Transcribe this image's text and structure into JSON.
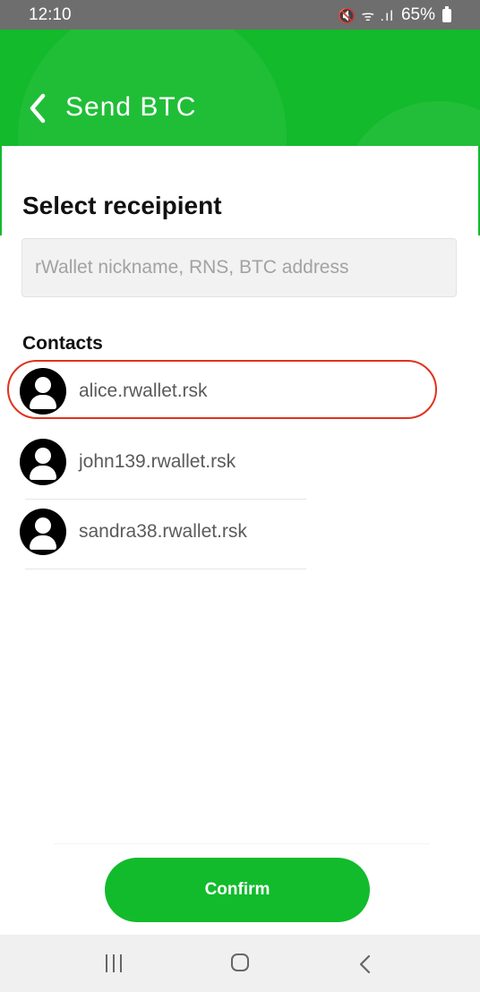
{
  "status_bar": {
    "time": "12:10",
    "icons": "🔇 ᯤ .ıl",
    "battery": "65%"
  },
  "header": {
    "back_icon": "chevron-left-icon",
    "title": "Send  BTC"
  },
  "main": {
    "section_title": "Select receipient",
    "search": {
      "placeholder": "rWallet nickname, RNS, BTC address",
      "value": ""
    },
    "contacts_label": "Contacts",
    "contacts": [
      {
        "name": "alice.rwallet.rsk",
        "avatar_icon": "user-icon",
        "highlighted": true
      },
      {
        "name": "john139.rwallet.rsk",
        "avatar_icon": "user-icon",
        "highlighted": false
      },
      {
        "name": "sandra38.rwallet.rsk",
        "avatar_icon": "user-icon",
        "highlighted": false
      }
    ]
  },
  "footer": {
    "confirm_label": "Confirm"
  },
  "nav_bar": {
    "icons": [
      "recent-apps-icon",
      "home-icon",
      "back-icon"
    ]
  },
  "colors": {
    "brand_green": "#13ba2b",
    "highlight_red": "#e0321c",
    "status_bar": "#6e6e6e",
    "nav_bar": "#f0f0f0"
  }
}
